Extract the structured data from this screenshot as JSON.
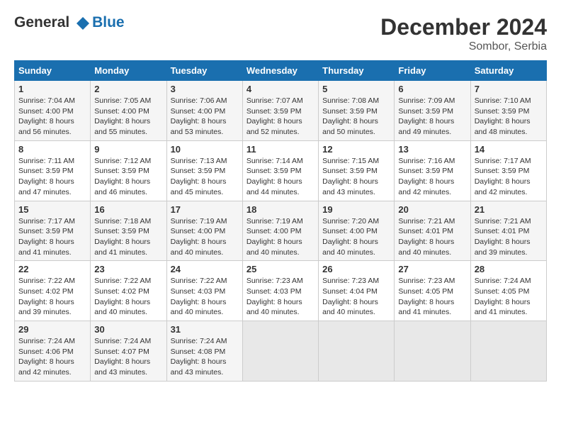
{
  "header": {
    "logo_line1": "General",
    "logo_line2": "Blue",
    "title": "December 2024",
    "subtitle": "Sombor, Serbia"
  },
  "columns": [
    "Sunday",
    "Monday",
    "Tuesday",
    "Wednesday",
    "Thursday",
    "Friday",
    "Saturday"
  ],
  "weeks": [
    [
      {
        "day": "1",
        "sunrise": "7:04 AM",
        "sunset": "4:00 PM",
        "daylight": "8 hours and 56 minutes."
      },
      {
        "day": "2",
        "sunrise": "7:05 AM",
        "sunset": "4:00 PM",
        "daylight": "8 hours and 55 minutes."
      },
      {
        "day": "3",
        "sunrise": "7:06 AM",
        "sunset": "4:00 PM",
        "daylight": "8 hours and 53 minutes."
      },
      {
        "day": "4",
        "sunrise": "7:07 AM",
        "sunset": "3:59 PM",
        "daylight": "8 hours and 52 minutes."
      },
      {
        "day": "5",
        "sunrise": "7:08 AM",
        "sunset": "3:59 PM",
        "daylight": "8 hours and 50 minutes."
      },
      {
        "day": "6",
        "sunrise": "7:09 AM",
        "sunset": "3:59 PM",
        "daylight": "8 hours and 49 minutes."
      },
      {
        "day": "7",
        "sunrise": "7:10 AM",
        "sunset": "3:59 PM",
        "daylight": "8 hours and 48 minutes."
      }
    ],
    [
      {
        "day": "8",
        "sunrise": "7:11 AM",
        "sunset": "3:59 PM",
        "daylight": "8 hours and 47 minutes."
      },
      {
        "day": "9",
        "sunrise": "7:12 AM",
        "sunset": "3:59 PM",
        "daylight": "8 hours and 46 minutes."
      },
      {
        "day": "10",
        "sunrise": "7:13 AM",
        "sunset": "3:59 PM",
        "daylight": "8 hours and 45 minutes."
      },
      {
        "day": "11",
        "sunrise": "7:14 AM",
        "sunset": "3:59 PM",
        "daylight": "8 hours and 44 minutes."
      },
      {
        "day": "12",
        "sunrise": "7:15 AM",
        "sunset": "3:59 PM",
        "daylight": "8 hours and 43 minutes."
      },
      {
        "day": "13",
        "sunrise": "7:16 AM",
        "sunset": "3:59 PM",
        "daylight": "8 hours and 42 minutes."
      },
      {
        "day": "14",
        "sunrise": "7:17 AM",
        "sunset": "3:59 PM",
        "daylight": "8 hours and 42 minutes."
      }
    ],
    [
      {
        "day": "15",
        "sunrise": "7:17 AM",
        "sunset": "3:59 PM",
        "daylight": "8 hours and 41 minutes."
      },
      {
        "day": "16",
        "sunrise": "7:18 AM",
        "sunset": "3:59 PM",
        "daylight": "8 hours and 41 minutes."
      },
      {
        "day": "17",
        "sunrise": "7:19 AM",
        "sunset": "4:00 PM",
        "daylight": "8 hours and 40 minutes."
      },
      {
        "day": "18",
        "sunrise": "7:19 AM",
        "sunset": "4:00 PM",
        "daylight": "8 hours and 40 minutes."
      },
      {
        "day": "19",
        "sunrise": "7:20 AM",
        "sunset": "4:00 PM",
        "daylight": "8 hours and 40 minutes."
      },
      {
        "day": "20",
        "sunrise": "7:21 AM",
        "sunset": "4:01 PM",
        "daylight": "8 hours and 40 minutes."
      },
      {
        "day": "21",
        "sunrise": "7:21 AM",
        "sunset": "4:01 PM",
        "daylight": "8 hours and 39 minutes."
      }
    ],
    [
      {
        "day": "22",
        "sunrise": "7:22 AM",
        "sunset": "4:02 PM",
        "daylight": "8 hours and 39 minutes."
      },
      {
        "day": "23",
        "sunrise": "7:22 AM",
        "sunset": "4:02 PM",
        "daylight": "8 hours and 40 minutes."
      },
      {
        "day": "24",
        "sunrise": "7:22 AM",
        "sunset": "4:03 PM",
        "daylight": "8 hours and 40 minutes."
      },
      {
        "day": "25",
        "sunrise": "7:23 AM",
        "sunset": "4:03 PM",
        "daylight": "8 hours and 40 minutes."
      },
      {
        "day": "26",
        "sunrise": "7:23 AM",
        "sunset": "4:04 PM",
        "daylight": "8 hours and 40 minutes."
      },
      {
        "day": "27",
        "sunrise": "7:23 AM",
        "sunset": "4:05 PM",
        "daylight": "8 hours and 41 minutes."
      },
      {
        "day": "28",
        "sunrise": "7:24 AM",
        "sunset": "4:05 PM",
        "daylight": "8 hours and 41 minutes."
      }
    ],
    [
      {
        "day": "29",
        "sunrise": "7:24 AM",
        "sunset": "4:06 PM",
        "daylight": "8 hours and 42 minutes."
      },
      {
        "day": "30",
        "sunrise": "7:24 AM",
        "sunset": "4:07 PM",
        "daylight": "8 hours and 43 minutes."
      },
      {
        "day": "31",
        "sunrise": "7:24 AM",
        "sunset": "4:08 PM",
        "daylight": "8 hours and 43 minutes."
      },
      null,
      null,
      null,
      null
    ]
  ]
}
